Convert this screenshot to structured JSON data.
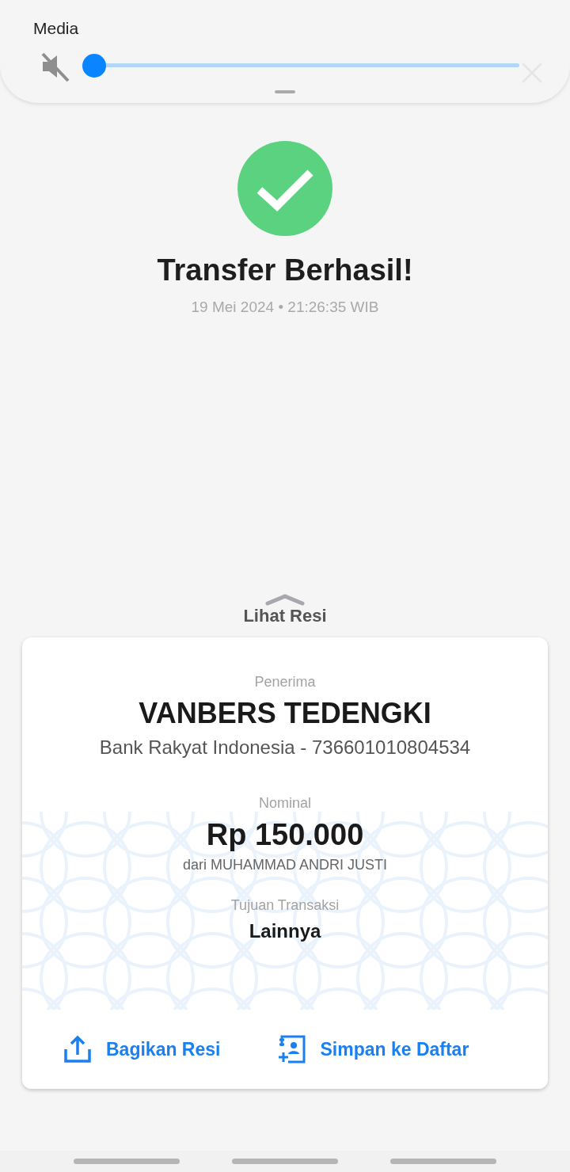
{
  "media_panel": {
    "label": "Media",
    "muted": true,
    "level": 0
  },
  "result": {
    "title": "Transfer Berhasil!",
    "date": "19 Mei 2024",
    "time": "21:26:35 WIB",
    "separator": "•"
  },
  "receipt_toggle": {
    "label": "Lihat Resi"
  },
  "receipt": {
    "recipient_label": "Penerima",
    "recipient_name": "VANBERS TEDENGKI",
    "recipient_account": "Bank Rakyat Indonesia - 736601010804534",
    "amount_label": "Nominal",
    "amount": "Rp 150.000",
    "sender": "dari MUHAMMAD ANDRI JUSTI",
    "purpose_label": "Tujuan Transaksi",
    "purpose": "Lainnya"
  },
  "actions": [
    {
      "kind": "share",
      "label": "Bagikan Resi"
    },
    {
      "kind": "save",
      "label": "Simpan ke Daftar"
    }
  ]
}
